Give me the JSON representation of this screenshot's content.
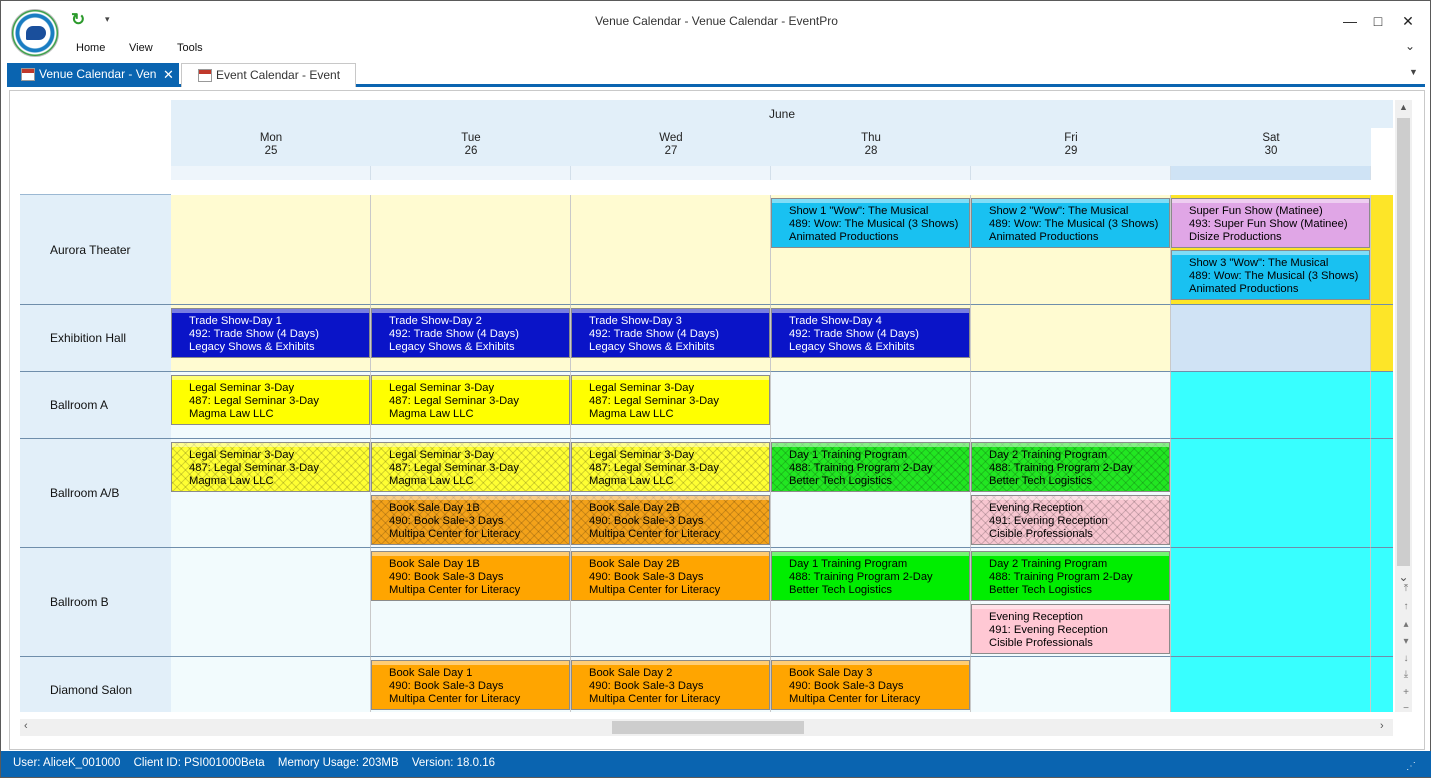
{
  "window": {
    "title": "Venue Calendar - Venue Calendar - EventPro"
  },
  "ribbon": {
    "menu": [
      "Home",
      "View",
      "Tools"
    ]
  },
  "tabs": [
    {
      "label": "Venue Calendar - Venue Calendar",
      "active": true
    },
    {
      "label": "Event Calendar - Event",
      "active": false
    }
  ],
  "calendar": {
    "month": "June",
    "days": [
      {
        "name": "Mon",
        "date": "25"
      },
      {
        "name": "Tue",
        "date": "26"
      },
      {
        "name": "Wed",
        "date": "27"
      },
      {
        "name": "Thu",
        "date": "28"
      },
      {
        "name": "Fri",
        "date": "29"
      },
      {
        "name": "Sat",
        "date": "30"
      }
    ],
    "rooms": [
      "Aurora Theater",
      "Exhibition Hall",
      "Ballroom A",
      "Ballroom A/B",
      "Ballroom B",
      "Diamond Salon"
    ],
    "events": [
      {
        "id": "aurora-thu",
        "lines": [
          "Show 1 \"Wow\": The Musical",
          "489: Wow: The Musical (3 Shows)",
          "Animated Productions"
        ],
        "color": "#19c1f1"
      },
      {
        "id": "aurora-fri",
        "lines": [
          "Show 2 \"Wow\": The Musical",
          "489: Wow: The Musical (3 Shows)",
          "Animated Productions"
        ],
        "color": "#19c1f1"
      },
      {
        "id": "aurora-sat-1",
        "lines": [
          "Super Fun Show (Matinee)",
          "493: Super Fun Show (Matinee)",
          "Disize Productions"
        ],
        "color": "#e0a6e6"
      },
      {
        "id": "aurora-sat-2",
        "lines": [
          "Show 3 \"Wow\": The Musical",
          "489: Wow: The Musical (3 Shows)",
          "Animated Productions"
        ],
        "color": "#19c1f1"
      },
      {
        "id": "exhibit-mon",
        "lines": [
          "Trade Show-Day 1",
          "492: Trade Show (4 Days)",
          "Legacy Shows & Exhibits"
        ],
        "color": "#0a14c8"
      },
      {
        "id": "exhibit-tue",
        "lines": [
          "Trade Show-Day 2",
          "492: Trade Show (4 Days)",
          "Legacy Shows & Exhibits"
        ],
        "color": "#0a14c8"
      },
      {
        "id": "exhibit-wed",
        "lines": [
          "Trade Show-Day 3",
          "492: Trade Show (4 Days)",
          "Legacy Shows & Exhibits"
        ],
        "color": "#0a14c8"
      },
      {
        "id": "exhibit-thu",
        "lines": [
          "Trade Show-Day 4",
          "492: Trade Show (4 Days)",
          "Legacy Shows & Exhibits"
        ],
        "color": "#0a14c8"
      },
      {
        "id": "ballA-mon",
        "lines": [
          "Legal Seminar 3-Day",
          "487: Legal Seminar 3-Day",
          "Magma Law LLC"
        ],
        "color": "#ffff00"
      },
      {
        "id": "ballA-tue",
        "lines": [
          "Legal Seminar 3-Day",
          "487: Legal Seminar 3-Day",
          "Magma Law LLC"
        ],
        "color": "#ffff00"
      },
      {
        "id": "ballA-wed",
        "lines": [
          "Legal Seminar 3-Day",
          "487: Legal Seminar 3-Day",
          "Magma Law LLC"
        ],
        "color": "#ffff00"
      },
      {
        "id": "ballAB-mon",
        "lines": [
          "Legal Seminar 3-Day",
          "487: Legal Seminar 3-Day",
          "Magma Law LLC"
        ],
        "color": "#ffff33"
      },
      {
        "id": "ballAB-tue",
        "lines": [
          "Legal Seminar 3-Day",
          "487: Legal Seminar 3-Day",
          "Magma Law LLC"
        ],
        "color": "#ffff33"
      },
      {
        "id": "ballAB-wed",
        "lines": [
          "Legal Seminar 3-Day",
          "487: Legal Seminar 3-Day",
          "Magma Law LLC"
        ],
        "color": "#ffff33"
      },
      {
        "id": "ballAB-thu",
        "lines": [
          "Day 1 Training Program",
          "488: Training Program 2-Day",
          "Better Tech Logistics"
        ],
        "color": "#22e622"
      },
      {
        "id": "ballAB-fri",
        "lines": [
          "Day 2 Training Program",
          "488: Training Program 2-Day",
          "Better Tech Logistics"
        ],
        "color": "#22e622"
      },
      {
        "id": "ballAB-tue-2",
        "lines": [
          "Book Sale Day 1B",
          "490: Book Sale-3 Days",
          "Multipa Center for Literacy"
        ],
        "color": "#f3a21a"
      },
      {
        "id": "ballAB-wed-2",
        "lines": [
          "Book Sale Day 2B",
          "490: Book Sale-3 Days",
          "Multipa Center for Literacy"
        ],
        "color": "#f3a21a"
      },
      {
        "id": "ballAB-fri-2",
        "lines": [
          "Evening Reception",
          "491: Evening Reception",
          "Cisible Professionals"
        ],
        "color": "#f7c6d0"
      },
      {
        "id": "ballB-tue",
        "lines": [
          "Book Sale Day 1B",
          "490: Book Sale-3 Days",
          "Multipa Center for Literacy"
        ],
        "color": "#ffa500"
      },
      {
        "id": "ballB-wed",
        "lines": [
          "Book Sale Day 2B",
          "490: Book Sale-3 Days",
          "Multipa Center for Literacy"
        ],
        "color": "#ffa500"
      },
      {
        "id": "ballB-thu",
        "lines": [
          "Day 1 Training Program",
          "488: Training Program 2-Day",
          "Better Tech Logistics"
        ],
        "color": "#00ee00"
      },
      {
        "id": "ballB-fri",
        "lines": [
          "Day 2 Training Program",
          "488: Training Program 2-Day",
          "Better Tech Logistics"
        ],
        "color": "#00ee00"
      },
      {
        "id": "ballB-fri-2",
        "lines": [
          "Evening Reception",
          "491: Evening Reception",
          "Cisible Professionals"
        ],
        "color": "#ffc8d4"
      },
      {
        "id": "diamond-tue",
        "lines": [
          "Book Sale Day 1",
          "490: Book Sale-3 Days",
          "Multipa Center for Literacy"
        ],
        "color": "#ffa500"
      },
      {
        "id": "diamond-wed",
        "lines": [
          "Book Sale Day 2",
          "490: Book Sale-3 Days",
          "Multipa Center for Literacy"
        ],
        "color": "#ffa500"
      },
      {
        "id": "diamond-thu",
        "lines": [
          "Book Sale Day 3",
          "490: Book Sale-3 Days",
          "Multipa Center for Literacy"
        ],
        "color": "#ffa500"
      }
    ]
  },
  "status": {
    "user": "User: AliceK_001000",
    "client": "Client ID: PSI001000Beta",
    "memory": "Memory Usage: 203MB",
    "version": "Version: 18.0.16"
  },
  "colors": {
    "accent": "#0a64b0",
    "header_bg": "#e2eff9",
    "available_beige": "#fffbd1",
    "available_light": "#f2fbfd",
    "weekend_cyan": "#38ffff"
  },
  "icons": {
    "logo": "eventpro-logo",
    "refresh": "refresh-icon",
    "calendar_tab": "calendar-icon"
  }
}
